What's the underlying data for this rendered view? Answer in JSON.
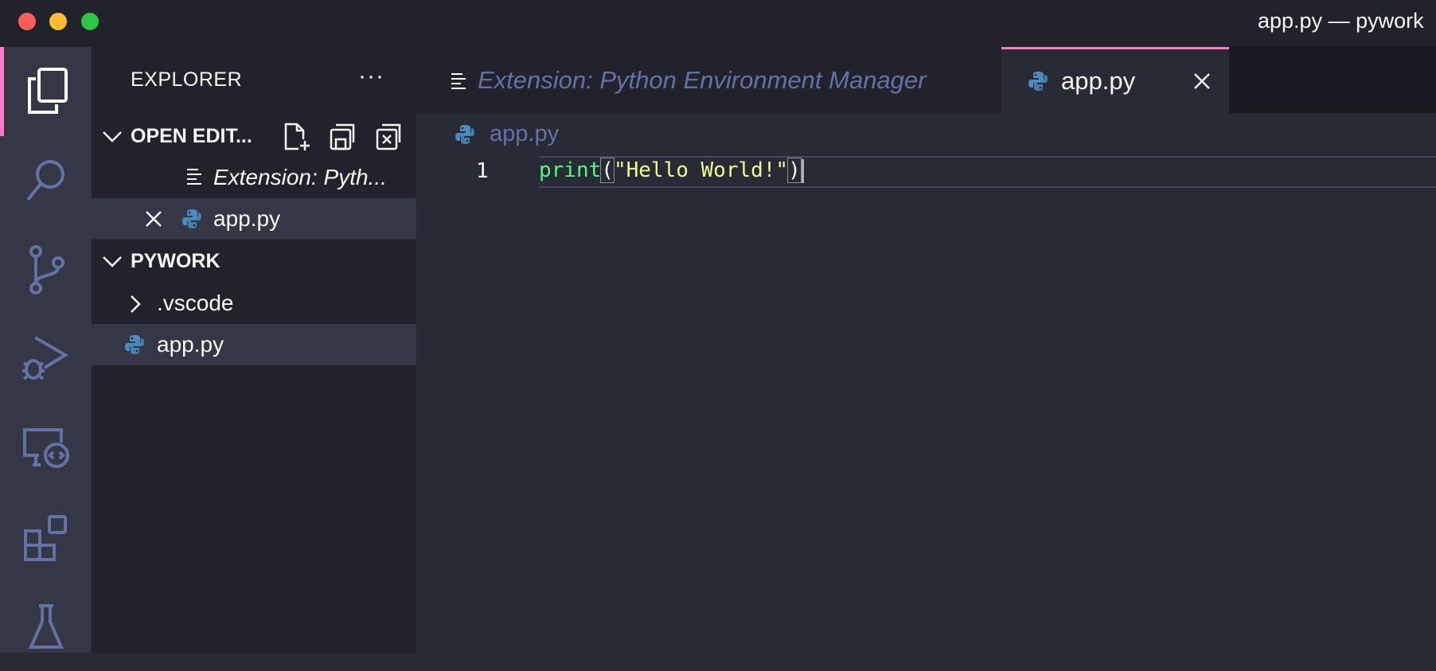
{
  "window": {
    "title": "app.py — pywork"
  },
  "activity_bar": {
    "items": [
      {
        "icon": "files-icon",
        "active": true
      },
      {
        "icon": "search-icon",
        "active": false
      },
      {
        "icon": "source-control-icon",
        "active": false
      },
      {
        "icon": "run-debug-icon",
        "active": false
      },
      {
        "icon": "remote-explorer-icon",
        "active": false
      },
      {
        "icon": "extensions-icon",
        "active": false
      },
      {
        "icon": "testing-icon",
        "active": false
      }
    ]
  },
  "sidebar": {
    "title": "EXPLORER",
    "more": "···",
    "open_editors": {
      "label": "OPEN EDIT...",
      "items": [
        {
          "label": "Extension: Pyth...",
          "icon": "preview-icon"
        },
        {
          "label": "app.py",
          "icon": "python-icon"
        }
      ]
    },
    "workspace": {
      "label": "PYWORK",
      "items": [
        {
          "label": ".vscode",
          "type": "folder"
        },
        {
          "label": "app.py",
          "type": "file"
        }
      ]
    }
  },
  "tabs": [
    {
      "label": "Extension: Python Environment Manager",
      "active": false
    },
    {
      "label": "app.py",
      "active": true
    }
  ],
  "breadcrumb": {
    "file": "app.py"
  },
  "editor": {
    "line_number": "1",
    "tokens": {
      "fn": "print",
      "open": "(",
      "str": "\"Hello World!\"",
      "close": ")"
    }
  },
  "colors": {
    "accent": "#ff79c6",
    "python_blue": "#4b8bbe",
    "python_yellow": "#ffd43b",
    "string": "#f1fa8c",
    "function": "#50fa7b"
  }
}
